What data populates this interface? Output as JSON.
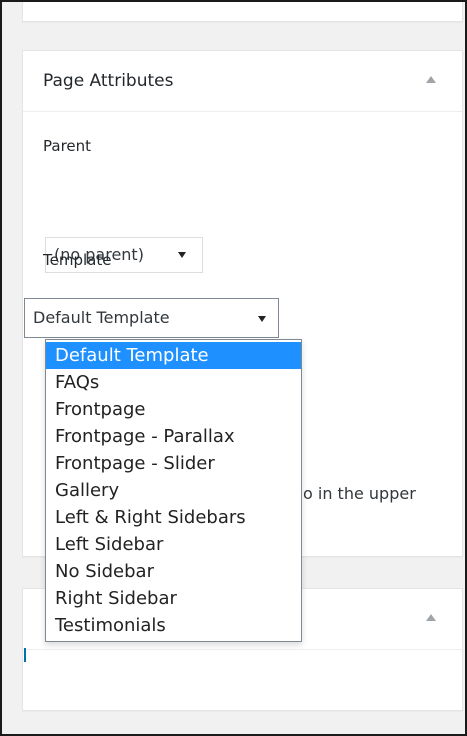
{
  "page_attributes": {
    "title": "Page Attributes",
    "parent_label": "Parent",
    "parent_value": "(no parent)",
    "template_label": "Template",
    "template_value": "Default Template",
    "template_options": [
      "Default Template",
      "FAQs",
      "Frontpage",
      "Frontpage - Parallax",
      "Frontpage - Slider",
      "Gallery",
      "Left & Right Sidebars",
      "Left Sidebar",
      "No Sidebar",
      "Right Sidebar",
      "Testimonials"
    ],
    "highlighted_option": "Default Template",
    "partially_hidden_text": "o in the upper"
  },
  "colors": {
    "highlight": "#1e90ff",
    "link": "#0073aa"
  },
  "icons": {
    "collapse_toggle": "triangle-up-icon",
    "select_caret": "caret-down-icon"
  }
}
